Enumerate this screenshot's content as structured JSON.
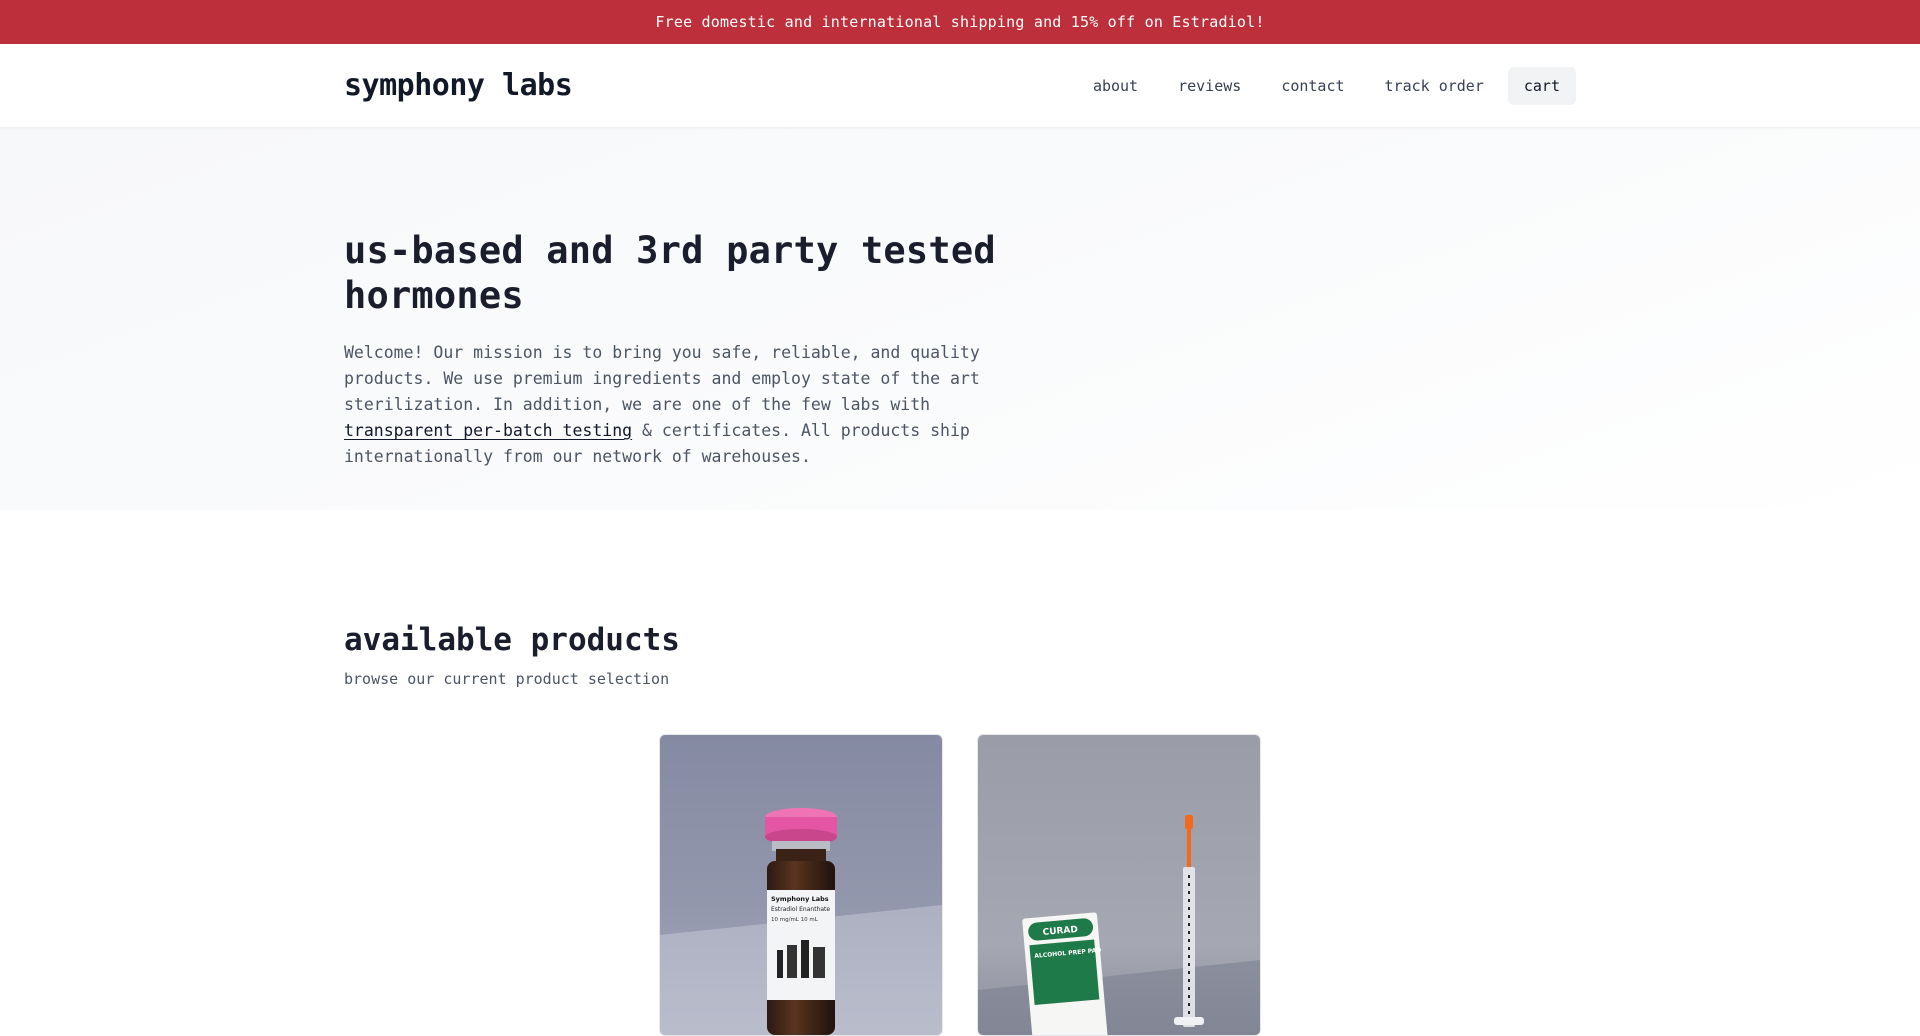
{
  "promo": {
    "text": "Free domestic and international shipping and 15% off on Estradiol!"
  },
  "header": {
    "logo": "symphony labs",
    "nav": [
      {
        "label": "about"
      },
      {
        "label": "reviews"
      },
      {
        "label": "contact"
      },
      {
        "label": "track order"
      },
      {
        "label": "cart"
      }
    ]
  },
  "hero": {
    "title": "us-based and 3rd party tested hormones",
    "body_before": "Welcome! Our mission is to bring you safe, reliable, and quality products. We use premium ingredients and employ state of the art sterilization. In addition, we are one of the few labs with ",
    "link_text": "transparent per-batch testing",
    "body_after": " & certificates. All products ship internationally from our network of warehouses."
  },
  "products": {
    "title": "available products",
    "subtitle": "browse our current product selection",
    "items": [
      {
        "image": "vial-photo",
        "label_brand": "Symphony Labs",
        "label_name": "Estradiol Enanthate",
        "label_spec": "10 mg/mL  10 mL"
      },
      {
        "image": "syringe-and-alcohol-pad-photo",
        "pad_brand": "CURAD",
        "pad_text": "ALCOHOL PREP PAD"
      }
    ]
  },
  "colors": {
    "promo_bg": "#bd2f3a",
    "text": "#111827",
    "muted": "#4b5563"
  }
}
